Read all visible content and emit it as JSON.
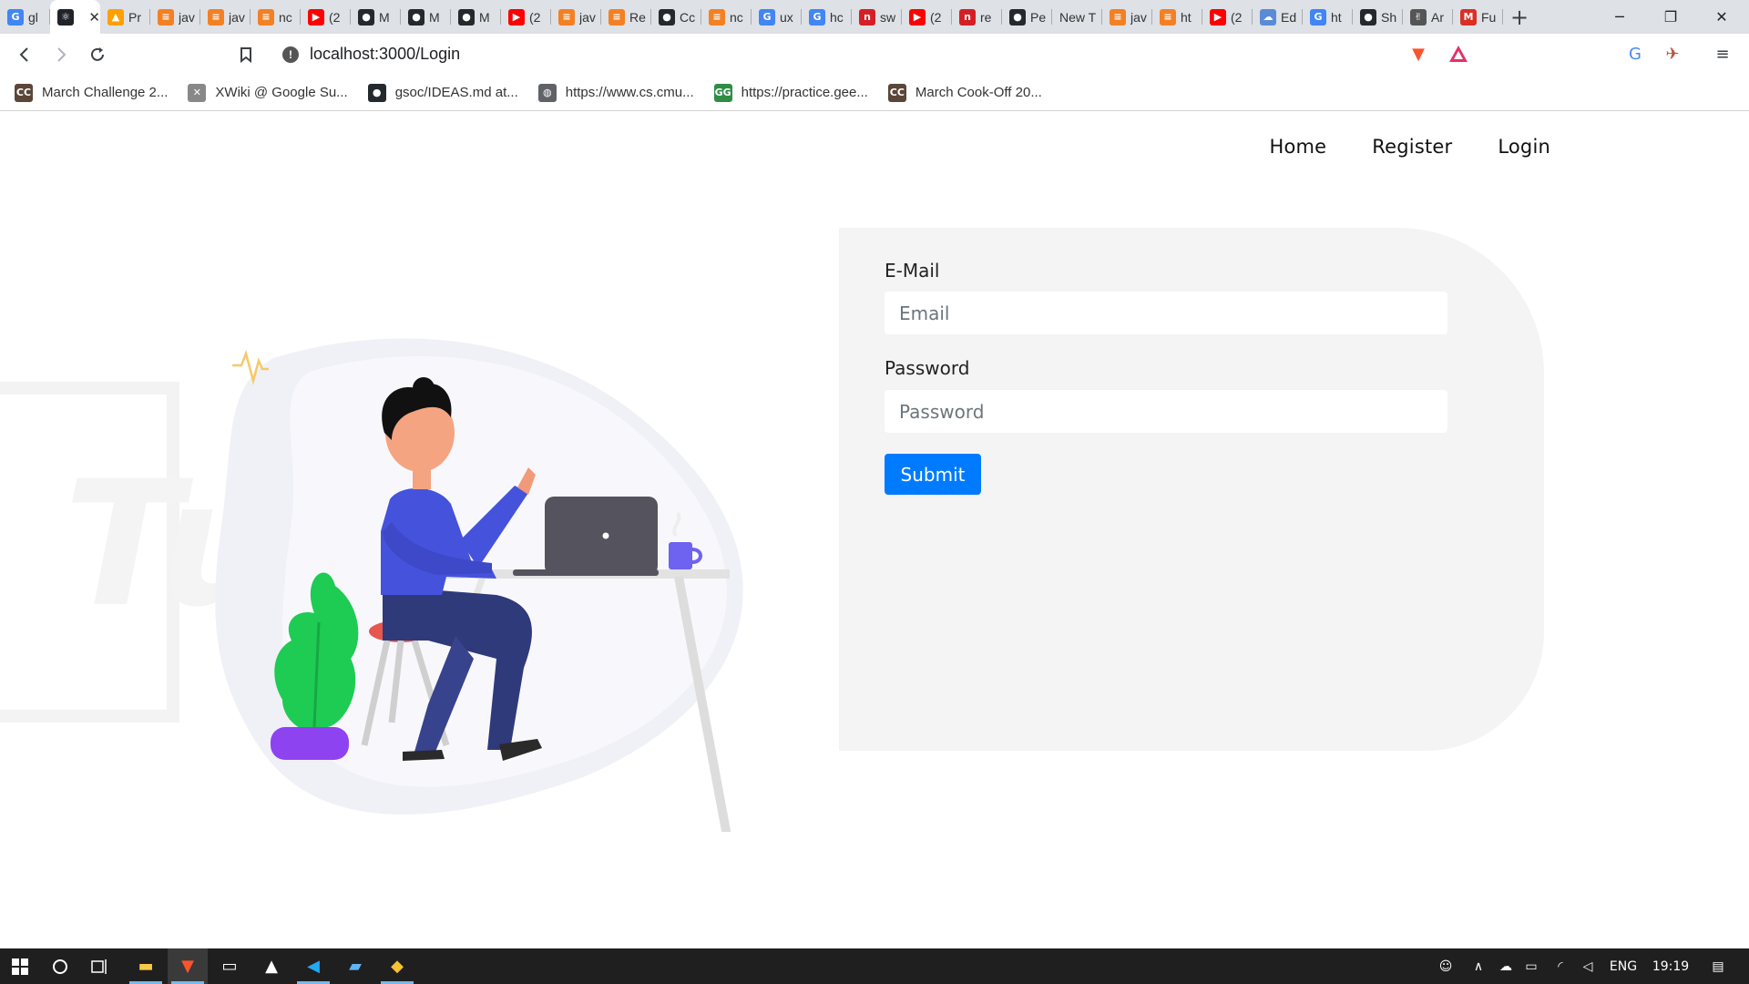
{
  "browser": {
    "tabs": [
      {
        "title": "gl",
        "icon": "google-icon",
        "color": "#4285f4",
        "glyph": "G"
      },
      {
        "title": "",
        "icon": "react-icon",
        "color": "#20232a",
        "glyph": "⚛",
        "active": true
      },
      {
        "title": "Pr",
        "icon": "firebase-icon",
        "color": "#ffa000",
        "glyph": "▲"
      },
      {
        "title": "jav",
        "icon": "stackoverflow-icon",
        "color": "#f48024",
        "glyph": "≡"
      },
      {
        "title": "jav",
        "icon": "stackoverflow-icon",
        "color": "#f48024",
        "glyph": "≡"
      },
      {
        "title": "nc",
        "icon": "stackoverflow-icon",
        "color": "#f48024",
        "glyph": "≡"
      },
      {
        "title": "(2",
        "icon": "youtube-icon",
        "color": "#ff0000",
        "glyph": "▶"
      },
      {
        "title": "M",
        "icon": "github-icon",
        "color": "#24292e",
        "glyph": "●"
      },
      {
        "title": "M",
        "icon": "github-icon",
        "color": "#24292e",
        "glyph": "●"
      },
      {
        "title": "M",
        "icon": "github-icon",
        "color": "#24292e",
        "glyph": "●"
      },
      {
        "title": "(2",
        "icon": "youtube-icon",
        "color": "#ff0000",
        "glyph": "▶"
      },
      {
        "title": "jav",
        "icon": "stackoverflow-icon",
        "color": "#f48024",
        "glyph": "≡"
      },
      {
        "title": "Re",
        "icon": "stackoverflow-icon",
        "color": "#f48024",
        "glyph": "≡"
      },
      {
        "title": "Cc",
        "icon": "github-icon",
        "color": "#24292e",
        "glyph": "●"
      },
      {
        "title": "nc",
        "icon": "stackoverflow-icon",
        "color": "#f48024",
        "glyph": "≡"
      },
      {
        "title": "ux",
        "icon": "google-icon",
        "color": "#4285f4",
        "glyph": "G"
      },
      {
        "title": "hc",
        "icon": "google-icon",
        "color": "#4285f4",
        "glyph": "G"
      },
      {
        "title": "sw",
        "icon": "n-icon",
        "color": "#d41f26",
        "glyph": "n"
      },
      {
        "title": "(2",
        "icon": "youtube-icon",
        "color": "#ff0000",
        "glyph": "▶"
      },
      {
        "title": "re",
        "icon": "n-icon",
        "color": "#d41f26",
        "glyph": "n"
      },
      {
        "title": "Pe",
        "icon": "github-icon",
        "color": "#24292e",
        "glyph": "●"
      },
      {
        "title": "New T",
        "icon": "",
        "color": "transparent",
        "glyph": ""
      },
      {
        "title": "jav",
        "icon": "stackoverflow-icon",
        "color": "#f48024",
        "glyph": "≡"
      },
      {
        "title": "ht",
        "icon": "stackoverflow-icon",
        "color": "#f48024",
        "glyph": "≡"
      },
      {
        "title": "(2",
        "icon": "youtube-icon",
        "color": "#ff0000",
        "glyph": "▶"
      },
      {
        "title": "Ed",
        "icon": "cloud-icon",
        "color": "#5b8bd6",
        "glyph": "☁"
      },
      {
        "title": "ht",
        "icon": "google-icon",
        "color": "#4285f4",
        "glyph": "G"
      },
      {
        "title": "Sh",
        "icon": "github-icon",
        "color": "#24292e",
        "glyph": "●"
      },
      {
        "title": "Ar",
        "icon": "peace-icon",
        "color": "#555555",
        "glyph": "✌"
      },
      {
        "title": "Fu",
        "icon": "gmail-icon",
        "color": "#d93025",
        "glyph": "M"
      }
    ],
    "url": "localhost:3000/Login",
    "bookmarks": [
      {
        "label": "March Challenge 2...",
        "icon": "codechef-icon",
        "color": "#5b4638",
        "glyph": "CC"
      },
      {
        "label": "XWiki @ Google Su...",
        "icon": "xwiki-icon",
        "color": "#888888",
        "glyph": "✕"
      },
      {
        "label": "gsoc/IDEAS.md at...",
        "icon": "github-icon",
        "color": "#24292e",
        "glyph": "●"
      },
      {
        "label": "https://www.cs.cmu...",
        "icon": "globe-icon",
        "color": "#5f6368",
        "glyph": "◍"
      },
      {
        "label": "https://practice.gee...",
        "icon": "gfg-icon",
        "color": "#2f8d46",
        "glyph": "GG"
      },
      {
        "label": "March Cook-Off 20...",
        "icon": "codechef-icon",
        "color": "#5b4638",
        "glyph": "CC"
      }
    ]
  },
  "nav": {
    "home": "Home",
    "register": "Register",
    "login": "Login"
  },
  "form": {
    "email_label": "E-Mail",
    "email_placeholder": "Email",
    "password_label": "Password",
    "password_placeholder": "Password",
    "submit_label": "Submit"
  },
  "taskbar": {
    "language": "ENG",
    "time": "19:19"
  },
  "colors": {
    "accent": "#007bff",
    "panel": "#f4f4f4"
  }
}
